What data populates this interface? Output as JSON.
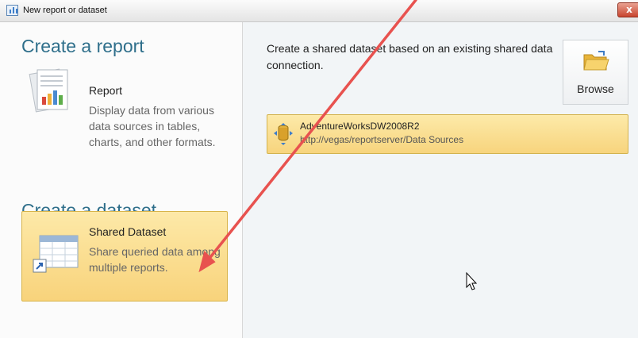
{
  "window": {
    "title": "New report or dataset",
    "close_label": "x"
  },
  "left": {
    "report_heading": "Create a report",
    "report_item": {
      "title": "Report",
      "description": "Display data from various data sources in tables, charts, and other formats."
    },
    "dataset_heading": "Create a dataset",
    "dataset_item": {
      "title": "Shared Dataset",
      "description": "Share queried data among multiple reports."
    }
  },
  "right": {
    "description": "Create a shared dataset based on an existing shared data connection.",
    "browse_label": "Browse",
    "source": {
      "name": "AdventureWorksDW2008R2",
      "url": "http://vegas/reportserver/Data Sources"
    }
  },
  "colors": {
    "accent_heading": "#2f6f8b",
    "selection_fill": "#f8d37b",
    "annotation_arrow": "#e8524f"
  }
}
